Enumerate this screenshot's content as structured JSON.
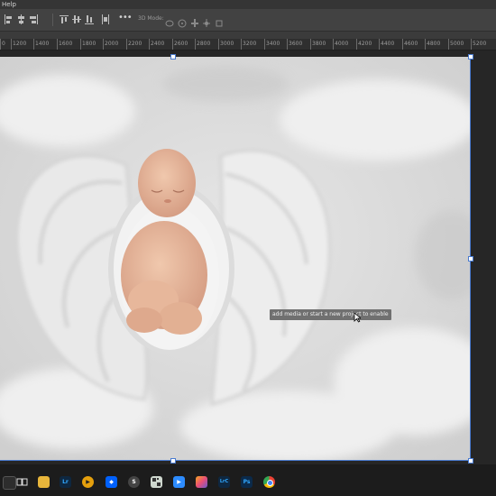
{
  "menu": {
    "help_label": "Help"
  },
  "options_bar": {
    "mode_label": "3D Mode:"
  },
  "ruler": {
    "ticks": [
      "0",
      "1200",
      "1400",
      "1600",
      "1800",
      "2000",
      "2200",
      "2400",
      "2600",
      "2800",
      "3000",
      "3200",
      "3400",
      "3600",
      "3800",
      "4000",
      "4200",
      "4400",
      "4600",
      "4800",
      "5000",
      "5200"
    ]
  },
  "canvas": {
    "tooltip": "add media or start a new project to enable"
  },
  "taskbar": {
    "apps": [
      {
        "name": "task-view-icon",
        "label": ""
      },
      {
        "name": "file-explorer-icon",
        "label": ""
      },
      {
        "name": "lightroom-icon",
        "label": "Lr"
      },
      {
        "name": "plex-icon",
        "label": "▶"
      },
      {
        "name": "dropbox-icon",
        "label": "◆"
      },
      {
        "name": "app-s-icon",
        "label": "S"
      },
      {
        "name": "qr-app-icon",
        "label": ""
      },
      {
        "name": "zoom-icon",
        "label": "▶"
      },
      {
        "name": "photos-icon",
        "label": ""
      },
      {
        "name": "lightroom-classic-icon",
        "label": "LrC"
      },
      {
        "name": "photoshop-icon",
        "label": "Ps"
      },
      {
        "name": "chrome-icon",
        "label": ""
      }
    ]
  },
  "colors": {
    "accent": "#4a7bd0",
    "photoshop": "#0b2a4a",
    "lightroom": "#0e2740"
  }
}
